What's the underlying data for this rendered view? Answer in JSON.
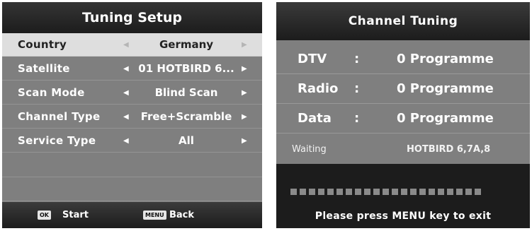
{
  "tuning_setup": {
    "title": "Tuning Setup",
    "rows": [
      {
        "label": "Country",
        "value": "Germany",
        "selected": true
      },
      {
        "label": "Satellite",
        "value": "01 HOTBIRD 6..."
      },
      {
        "label": "Scan Mode",
        "value": "Blind Scan"
      },
      {
        "label": "Channel Type",
        "value": "Free+Scramble"
      },
      {
        "label": "Service Type",
        "value": "All"
      }
    ],
    "arrow_left": "◀",
    "arrow_right": "▶",
    "footer": {
      "ok_key": "OK",
      "ok_label": "Start",
      "menu_key": "MENU",
      "menu_label": "Back"
    }
  },
  "channel_tuning": {
    "title": "Channel Tuning",
    "rows": [
      {
        "label": "DTV",
        "colon": ":",
        "value": "0 Programme"
      },
      {
        "label": "Radio",
        "colon": ":",
        "value": "0 Programme"
      },
      {
        "label": "Data",
        "colon": ":",
        "value": "0 Programme"
      }
    ],
    "status_label": "Waiting",
    "status_value": "HOTBIRD 6,7A,8",
    "progress_segments": 21,
    "progress_fraction": 0,
    "hint": "Please press MENU key to exit"
  }
}
